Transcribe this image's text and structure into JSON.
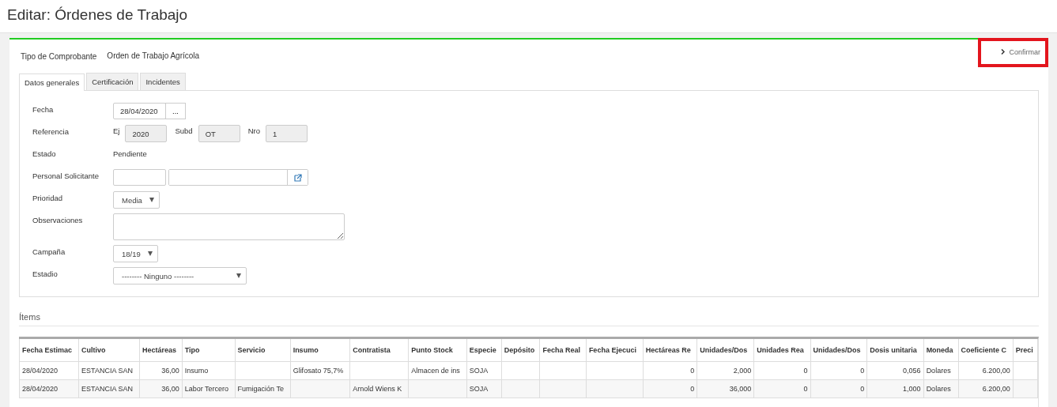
{
  "page_title": "Editar: Órdenes de Trabajo",
  "voucher": {
    "label": "Tipo de Comprobante",
    "value": "Orden de Trabajo Agrícola"
  },
  "confirm": {
    "label": "Confirmar",
    "highlighted": true
  },
  "tabs": [
    {
      "label": "Datos generales",
      "selected": true
    },
    {
      "label": "Certificación",
      "selected": false
    },
    {
      "label": "Incidentes",
      "selected": false
    }
  ],
  "form": {
    "fecha": {
      "label": "Fecha",
      "value": "28/04/2020",
      "button": "..."
    },
    "referencia": {
      "label": "Referencia",
      "ej": {
        "label": "Ej",
        "value": "2020"
      },
      "subd": {
        "label": "Subd",
        "value": "OT"
      },
      "nro": {
        "label": "Nro",
        "value": "1"
      }
    },
    "estado": {
      "label": "Estado",
      "value": "Pendiente"
    },
    "personal": {
      "label": "Personal Solicitante"
    },
    "prioridad": {
      "label": "Prioridad",
      "value": "Media"
    },
    "observaciones": {
      "label": "Observaciones"
    },
    "campana": {
      "label": "Campaña",
      "value": "18/19"
    },
    "estadio": {
      "label": "Estadio",
      "value": "-------- Ninguno --------"
    }
  },
  "items": {
    "title": "Ítems",
    "columns": [
      {
        "label": "Fecha Estimac",
        "kind": "text"
      },
      {
        "label": "Cultivo",
        "kind": "text"
      },
      {
        "label": "Hectáreas",
        "kind": "number"
      },
      {
        "label": "Tipo",
        "kind": "text"
      },
      {
        "label": "Servicio",
        "kind": "text"
      },
      {
        "label": "Insumo",
        "kind": "text"
      },
      {
        "label": "Contratista",
        "kind": "text"
      },
      {
        "label": "Punto Stock",
        "kind": "text"
      },
      {
        "label": "Especie",
        "kind": "text"
      },
      {
        "label": "Depósito",
        "kind": "text"
      },
      {
        "label": "Fecha Real",
        "kind": "text"
      },
      {
        "label": "Fecha Ejecuci",
        "kind": "text"
      },
      {
        "label": "Hectáreas Re",
        "kind": "number"
      },
      {
        "label": "Unidades/Dos",
        "kind": "number"
      },
      {
        "label": "Unidades Rea",
        "kind": "number"
      },
      {
        "label": "Unidades/Dos",
        "kind": "number"
      },
      {
        "label": "Dosis unitaria",
        "kind": "number"
      },
      {
        "label": "Moneda",
        "kind": "text"
      },
      {
        "label": "Coeficiente C",
        "kind": "number"
      },
      {
        "label": "Preci",
        "kind": "text"
      }
    ],
    "rows": [
      [
        "28/04/2020",
        "ESTANCIA SAN",
        "36,00",
        "Insumo",
        "",
        "Glifosato 75,7%",
        "",
        "Almacen de ins",
        "SOJA",
        "",
        "",
        "",
        "0",
        "2,000",
        "0",
        "0",
        "0,056",
        "Dolares",
        "6.200,00",
        ""
      ],
      [
        "28/04/2020",
        "ESTANCIA SAN",
        "36,00",
        "Labor Tercero",
        "Fumigación Te",
        "",
        "Arnold Wiens K",
        "",
        "SOJA",
        "",
        "",
        "",
        "0",
        "36,000",
        "0",
        "0",
        "1,000",
        "Dolares",
        "6.200,00",
        ""
      ]
    ]
  }
}
